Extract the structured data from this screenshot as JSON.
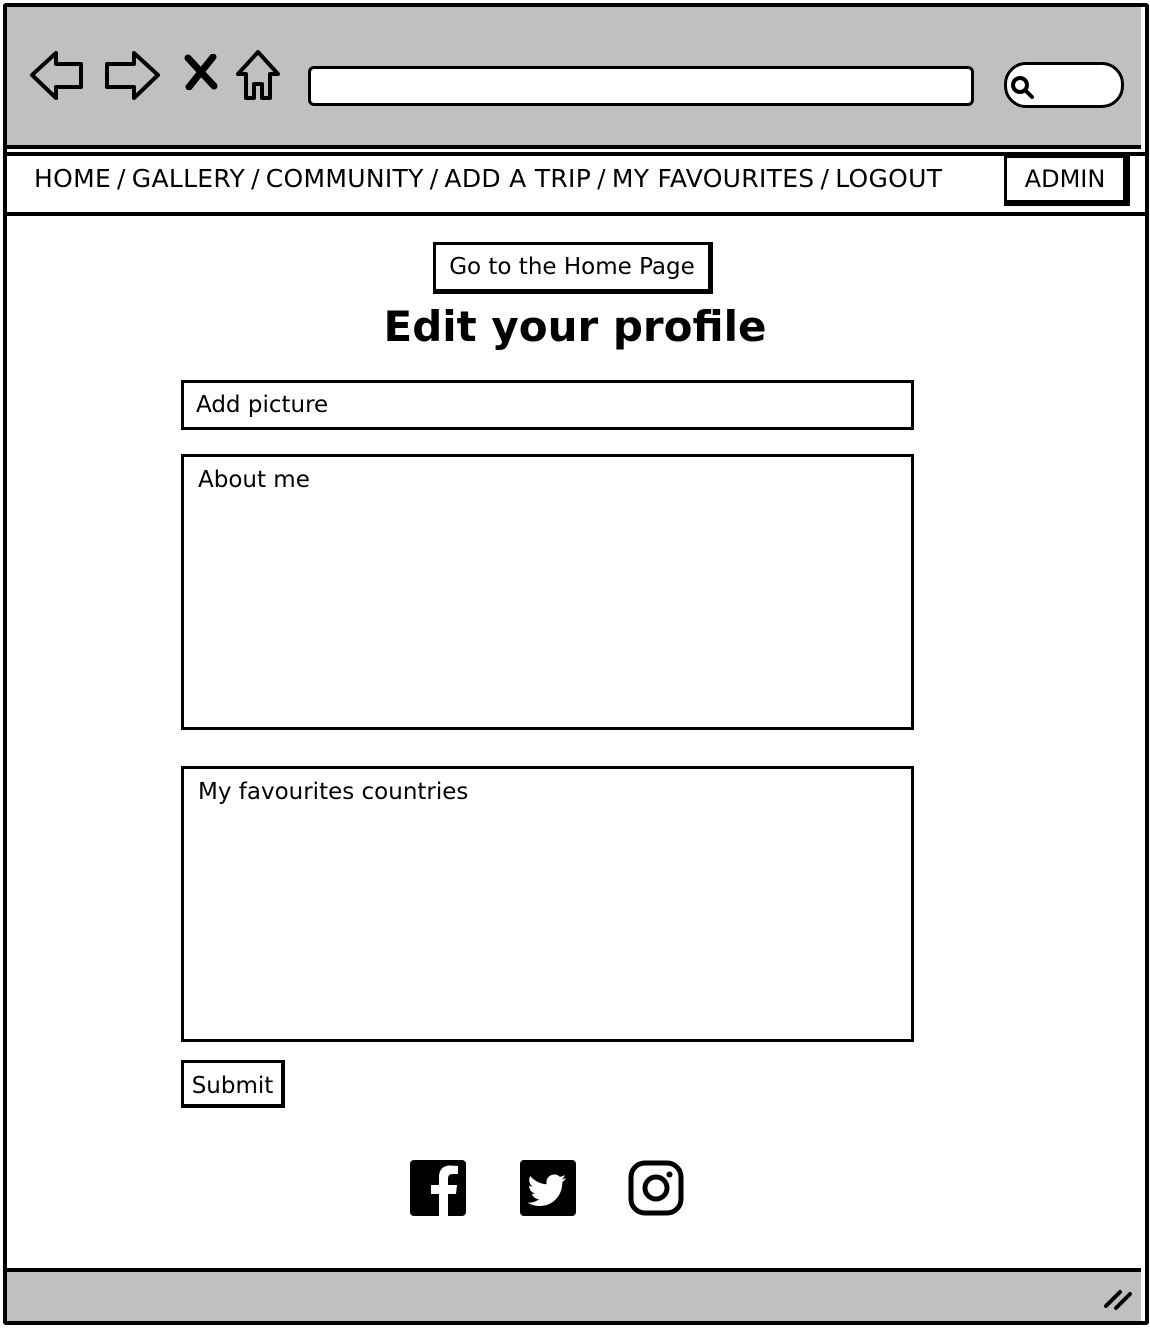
{
  "toolbar": {
    "icons": [
      "back-arrow-icon",
      "forward-arrow-icon",
      "close-icon",
      "home-icon",
      "search-icon"
    ],
    "url_value": ""
  },
  "nav": {
    "links": [
      "HOME",
      "GALLERY",
      "COMMUNITY",
      "ADD A TRIP",
      "MY FAVOURITES",
      "LOGOUT"
    ],
    "separator": "/",
    "admin_label": "ADMIN"
  },
  "main": {
    "home_button_label": "Go to the Home Page",
    "title": "Edit your profile",
    "fields": {
      "picture_placeholder": "Add picture",
      "about_placeholder": "About me",
      "favourites_placeholder": "My favourites countries"
    },
    "submit_label": "Submit"
  },
  "footer": {
    "social_icons": [
      "facebook-icon",
      "twitter-icon",
      "instagram-icon"
    ]
  },
  "colors": {
    "chrome": "#c0c0c0",
    "ink": "#000000",
    "paper": "#ffffff"
  }
}
